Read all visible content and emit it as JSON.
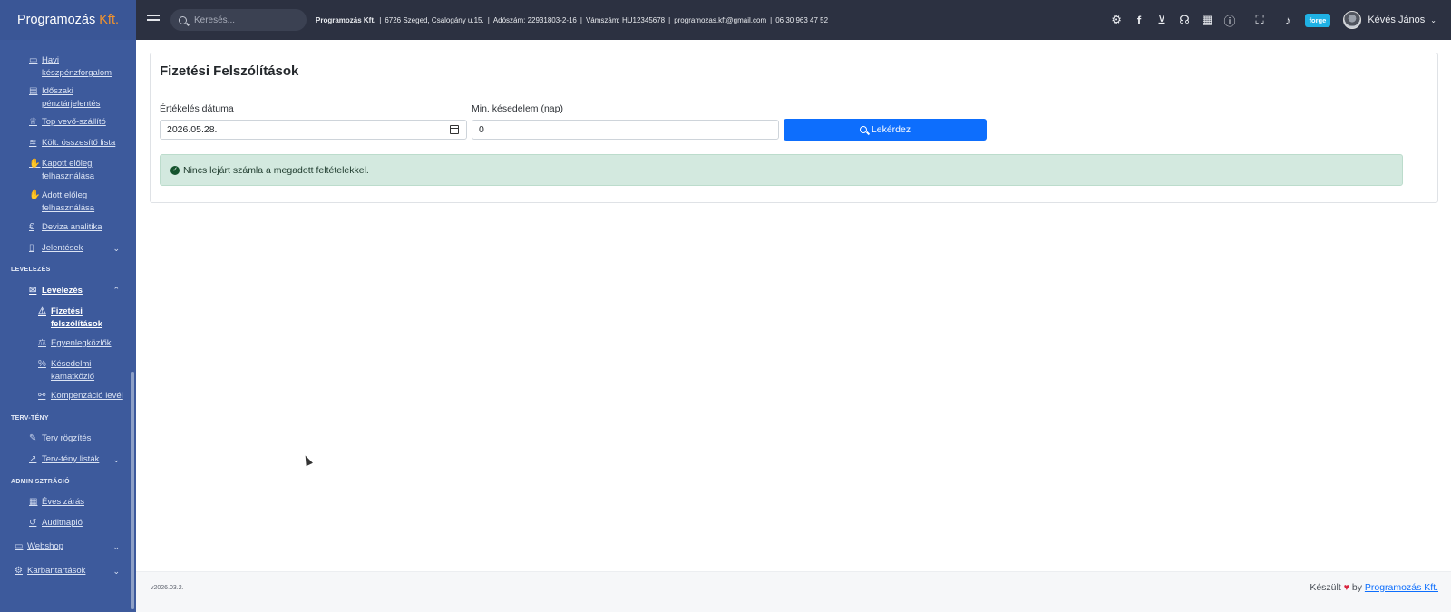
{
  "brand": {
    "name": "Programozás",
    "suffix": "Kft."
  },
  "sidebar": {
    "items_top": [
      {
        "label": "Havi készpénzforgalom",
        "icon": "cash-icon"
      },
      {
        "label": "Időszaki pénztárjelentés",
        "icon": "register-icon"
      },
      {
        "label": "Top vevő-szállító",
        "icon": "trophy-icon"
      },
      {
        "label": "Költ. összesítő lista",
        "icon": "layers-icon"
      },
      {
        "label": "Kapott előleg felhasználása",
        "icon": "hand-coin-icon"
      },
      {
        "label": "Adott előleg felhasználása",
        "icon": "hand-coin-icon"
      },
      {
        "label": "Deviza analitika",
        "icon": "euro-icon"
      },
      {
        "label": "Jelentések",
        "icon": "document-icon"
      }
    ],
    "sections": {
      "levelezes": "LEVELEZÉS",
      "terv_teny": "TERV-TÉNY",
      "adminisztracio": "ADMINISZTRÁCIÓ"
    },
    "levelezes_group": "Levelezés",
    "levelezes_items": [
      {
        "label": "Fizetési felszólítások",
        "icon": "warning-icon"
      },
      {
        "label": "Egyenlegközlők",
        "icon": "scale-icon"
      },
      {
        "label": "Késedelmi kamatközlő",
        "icon": "percent-icon"
      },
      {
        "label": "Kompenzáció levél",
        "icon": "handshake-icon"
      }
    ],
    "terv_items": [
      {
        "label": "Terv rögzítés",
        "icon": "edit-icon"
      },
      {
        "label": "Terv-tény listák",
        "icon": "chart-line-icon"
      }
    ],
    "admin_items": [
      {
        "label": "Éves zárás",
        "icon": "calendar-check-icon"
      },
      {
        "label": "Auditnapló",
        "icon": "history-icon"
      }
    ],
    "bottom_items": [
      {
        "label": "Webshop",
        "icon": "store-icon"
      },
      {
        "label": "Karbantartások",
        "icon": "gear-icon"
      }
    ]
  },
  "topbar": {
    "search_placeholder": "Keresés...",
    "company_name": "Programozás Kft.",
    "company_address": "6726 Szeged, Csalogány u.15.",
    "tax_number": "Adószám: 22931803-2-16",
    "vat_number": "Vámszám: HU12345678",
    "email": "programozas.kft@gmail.com",
    "phone": "06 30 963 47 52",
    "forge_badge": "forge",
    "user_name": "Kévés János"
  },
  "page": {
    "title": "Fizetési Felszólítások",
    "date_label": "Értékelés dátuma",
    "date_value": "2026.05.28.",
    "delay_label": "Min. késedelem (nap)",
    "delay_value": "0",
    "query_button": "Lekérdez",
    "alert_text": "Nincs lejárt számla a megadott feltételekkel."
  },
  "footer": {
    "version": "v2026.03.2.",
    "made_prefix": "Készült",
    "made_by": "by",
    "made_link": "Programozás Kft."
  }
}
